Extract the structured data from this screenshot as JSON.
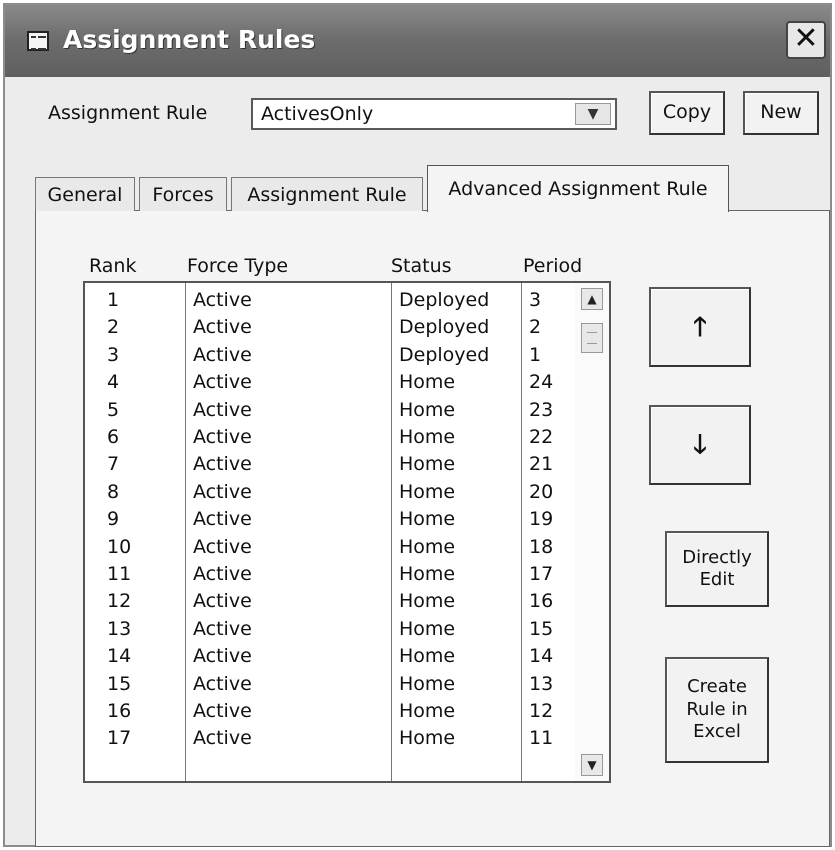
{
  "window": {
    "title": "Assignment Rules",
    "close_glyph": "✕"
  },
  "header": {
    "rule_label": "Assignment Rule",
    "rule_value": "ActivesOnly",
    "copy_label": "Copy",
    "new_label": "New"
  },
  "tabs": [
    {
      "label": "General",
      "active": false
    },
    {
      "label": "Forces",
      "active": false
    },
    {
      "label": "Assignment Rule",
      "active": false
    },
    {
      "label": "Advanced Assignment Rule",
      "active": true
    }
  ],
  "list": {
    "columns": [
      "Rank",
      "Force Type",
      "Status",
      "Period"
    ],
    "rows": [
      [
        "1",
        "Active",
        "Deployed",
        "3"
      ],
      [
        "2",
        "Active",
        "Deployed",
        "2"
      ],
      [
        "3",
        "Active",
        "Deployed",
        "1"
      ],
      [
        "4",
        "Active",
        "Home",
        "24"
      ],
      [
        "5",
        "Active",
        "Home",
        "23"
      ],
      [
        "6",
        "Active",
        "Home",
        "22"
      ],
      [
        "7",
        "Active",
        "Home",
        "21"
      ],
      [
        "8",
        "Active",
        "Home",
        "20"
      ],
      [
        "9",
        "Active",
        "Home",
        "19"
      ],
      [
        "10",
        "Active",
        "Home",
        "18"
      ],
      [
        "11",
        "Active",
        "Home",
        "17"
      ],
      [
        "12",
        "Active",
        "Home",
        "16"
      ],
      [
        "13",
        "Active",
        "Home",
        "15"
      ],
      [
        "14",
        "Active",
        "Home",
        "14"
      ],
      [
        "15",
        "Active",
        "Home",
        "13"
      ],
      [
        "16",
        "Active",
        "Home",
        "12"
      ],
      [
        "17",
        "Active",
        "Home",
        "11"
      ]
    ]
  },
  "side_buttons": {
    "up_glyph": "🡑",
    "down_glyph": "🡓",
    "edit_label": "Directly Edit",
    "excel_label": "Create Rule in Excel"
  },
  "icons": {
    "window": "form-icon",
    "close": "close-icon",
    "combo": "chevron-down-icon",
    "up": "arrow-up-icon",
    "down": "arrow-down-icon"
  }
}
